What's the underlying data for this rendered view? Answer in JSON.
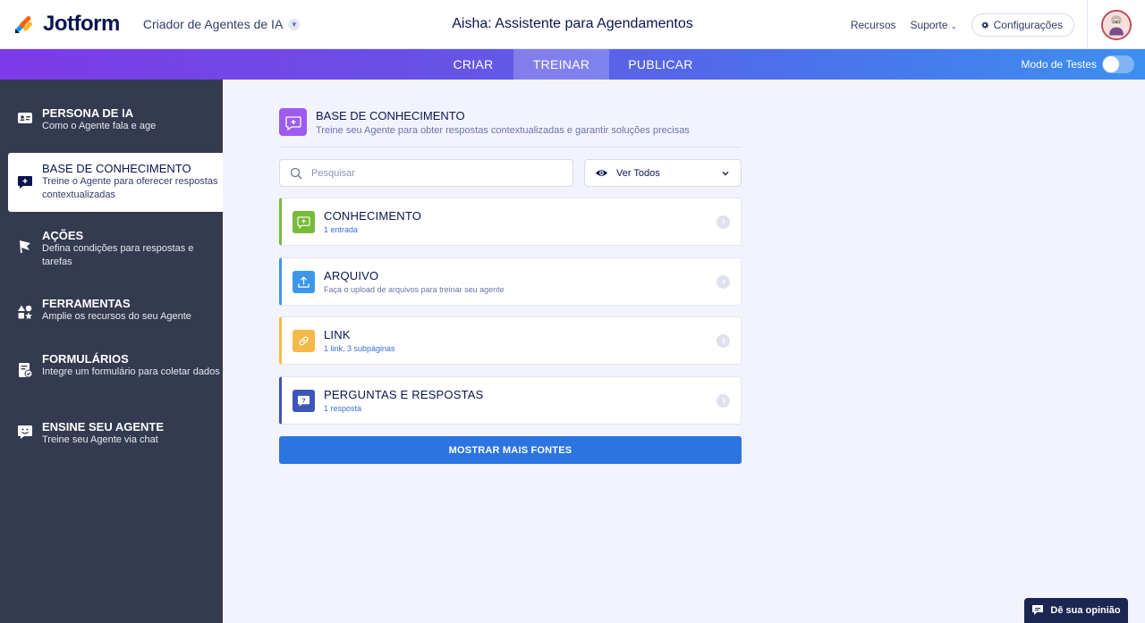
{
  "header": {
    "brand": "Jotform",
    "builder_label": "Criador de Agentes de IA",
    "title": "Aisha: Assistente para Agendamentos",
    "menu": {
      "resources": "Recursos",
      "support": "Suporte",
      "settings": "Configurações"
    }
  },
  "tabs": [
    {
      "label": "CRIAR"
    },
    {
      "label": "TREINAR",
      "active": true
    },
    {
      "label": "PUBLICAR"
    }
  ],
  "test_mode": {
    "label": "Modo de Testes",
    "enabled": false
  },
  "sidebar": {
    "items": [
      {
        "title": "PERSONA DE IA",
        "subtitle": "Como o Agente fala e age",
        "icon": "id-card-icon"
      },
      {
        "title": "BASE DE CONHECIMENTO",
        "subtitle": "Treine o Agente para oferecer respostas contextualizadas",
        "icon": "knowledge-chat-icon",
        "active": true
      },
      {
        "title": "AÇÕES",
        "subtitle": "Defina condições para respostas e tarefas",
        "icon": "flag-icon"
      },
      {
        "title": "FERRAMENTAS",
        "subtitle": "Amplie os recursos do seu Agente",
        "icon": "shapes-icon"
      },
      {
        "title": "FORMULÁRIOS",
        "subtitle": "Integre um formulário para coletar dados",
        "icon": "form-icon"
      },
      {
        "title": "ENSINE SEU AGENTE",
        "subtitle": "Treine seu Agente via chat",
        "icon": "chat-smile-icon"
      }
    ]
  },
  "main": {
    "section_title": "BASE DE CONHECIMENTO",
    "section_subtitle": "Treine seu Agente para obter respostas contextualizadas e garantir soluções precisas",
    "search_placeholder": "Pesquisar",
    "filter_label": "Ver Todos",
    "cards": [
      {
        "title": "CONHECIMENTO",
        "subtitle": "1 entrada",
        "color": "#78bb3b",
        "icon": "knowledge-plus-icon"
      },
      {
        "title": "ARQUIVO",
        "subtitle": "Faça o upload de arquivos para treinar seu agente",
        "color": "#3c97eb",
        "icon": "upload-icon"
      },
      {
        "title": "LINK",
        "subtitle": "1 link, 3 subpáginas",
        "color": "#f5b94a",
        "icon": "link-icon"
      },
      {
        "title": "PERGUNTAS E RESPOSTAS",
        "subtitle": "1 resposta",
        "color": "#3e55b8",
        "icon": "question-chat-icon"
      }
    ],
    "more_button": "MOSTRAR MAIS FONTES"
  },
  "feedback_button": "Dê sua opinião",
  "colors": {
    "sidebar_bg": "#343a4f",
    "main_bg": "#f3f3fe",
    "primary_button": "#2c74e0",
    "kb_badge": "#9e5bf0"
  }
}
